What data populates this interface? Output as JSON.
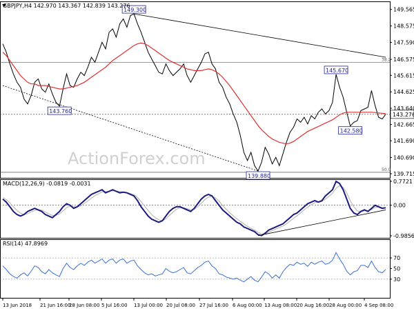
{
  "chart_data": {
    "type": "line",
    "symbol": "GBPJPY,H4",
    "header_values": "142.970 143.367 142.839 143.276",
    "x_tick_labels": [
      "13 Jun 2018",
      "21 Jun 16:00",
      "28 Jun 08:00",
      "5 Jul 16:00",
      "13 Jul 00:00",
      "20 Jul 08:00",
      "27 Jul 16:00",
      "6 Aug 00:00",
      "13 Aug 08:00",
      "20 Aug 16:00",
      "28 Aug 00:00",
      "4 Sep 08:00"
    ],
    "watermark": "ActionForex.com",
    "panels": {
      "price": {
        "ylim": [
          139.715,
          149.8
        ],
        "y_ticks": [
          "149.565",
          "148.575",
          "147.590",
          "146.575",
          "145.615",
          "144.625",
          "143.640",
          "142.665",
          "141.690",
          "140.690",
          "139.715"
        ],
        "last_price_label": "143.276",
        "series": [
          {
            "name": "Price",
            "color": "#000000",
            "values": [
              147.5,
              147.0,
              146.3,
              145.7,
              145.2,
              144.9,
              144.2,
              143.9,
              144.4,
              145.2,
              145.4,
              144.8,
              144.6,
              145.1,
              144.5,
              144.0,
              143.76,
              144.8,
              145.7,
              145.0,
              144.9,
              145.4,
              145.8,
              145.6,
              146.1,
              146.7,
              146.4,
              147.0,
              147.6,
              147.2,
              148.2,
              148.4,
              147.9,
              148.7,
              149.0,
              148.5,
              149.2,
              149.3,
              148.7,
              148.2,
              147.6,
              147.0,
              146.6,
              146.2,
              145.8,
              145.7,
              146.3,
              145.9,
              145.6,
              145.8,
              146.0,
              146.3,
              145.6,
              145.2,
              145.6,
              146.0,
              146.4,
              146.9,
              147.0,
              146.3,
              146.0,
              145.2,
              144.9,
              144.3,
              143.9,
              143.3,
              142.8,
              142.0,
              141.0,
              140.5,
              141.0,
              140.2,
              139.88,
              140.4,
              141.3,
              140.9,
              140.3,
              140.7,
              140.2,
              140.9,
              141.6,
              142.2,
              142.5,
              143.0,
              142.8,
              143.1,
              142.7,
              143.2,
              143.0,
              143.4,
              143.6,
              143.3,
              143.5,
              144.0,
              145.67,
              144.9,
              144.3,
              143.4,
              142.58,
              142.8,
              142.9,
              143.5,
              143.6,
              143.7,
              144.7,
              143.8,
              143.1,
              143.0,
              143.276
            ]
          },
          {
            "name": "SMA",
            "color": "#e03030",
            "values": [
              147.0,
              146.8,
              146.5,
              146.2,
              145.9,
              145.6,
              145.4,
              145.2,
              145.1,
              145.1,
              145.0,
              145.0,
              145.0,
              144.95,
              144.9,
              144.85,
              144.8,
              144.8,
              144.85,
              144.9,
              144.95,
              145.0,
              145.1,
              145.2,
              145.35,
              145.5,
              145.65,
              145.8,
              145.95,
              146.1,
              146.3,
              146.5,
              146.65,
              146.8,
              146.95,
              147.1,
              147.25,
              147.4,
              147.5,
              147.55,
              147.5,
              147.4,
              147.25,
              147.1,
              146.95,
              146.8,
              146.65,
              146.5,
              146.4,
              146.3,
              146.2,
              146.1,
              146.0,
              145.95,
              145.9,
              145.9,
              145.9,
              145.95,
              146.0,
              145.95,
              145.85,
              145.7,
              145.5,
              145.25,
              145.0,
              144.7,
              144.4,
              144.1,
              143.8,
              143.5,
              143.2,
              142.9,
              142.6,
              142.35,
              142.15,
              141.95,
              141.8,
              141.7,
              141.6,
              141.55,
              141.5,
              141.55,
              141.65,
              141.8,
              141.95,
              142.1,
              142.25,
              142.35,
              142.45,
              142.55,
              142.65,
              142.75,
              142.85,
              142.95,
              143.1,
              143.25,
              143.35,
              143.4,
              143.4,
              143.4,
              143.4,
              143.4,
              143.4,
              143.4,
              143.4,
              143.38,
              143.36,
              143.34,
              143.32
            ]
          }
        ],
        "annotations": [
          {
            "label": "149.300",
            "x": 37,
            "y": 149.3
          },
          {
            "label": "143.760",
            "x": 16,
            "y": 143.76
          },
          {
            "label": "139.880",
            "x": 72,
            "y": 139.88
          },
          {
            "label": "145.670",
            "x": 94,
            "y": 145.67
          },
          {
            "label": "142.580",
            "x": 98,
            "y": 142.58
          }
        ],
        "trendlines": [
          {
            "from": [
              37,
              149.3
            ],
            "to": [
              108,
              146.7
            ]
          },
          {
            "from": [
              0,
              145.0
            ],
            "to": [
              72,
              139.88
            ]
          }
        ],
        "hlines": [
          {
            "value": 146.4,
            "label": "38.2"
          },
          {
            "value": 139.8,
            "label": "50.0"
          },
          {
            "value": 143.276,
            "label": ""
          }
        ]
      },
      "macd": {
        "title": "MACD(12,26,9) -0.0819 -0.0031",
        "ylim": [
          -0.9856,
          0.7721
        ],
        "y_ticks": [
          "0.7721",
          "0.00",
          "-0.9856"
        ],
        "series": [
          {
            "name": "MACD",
            "color": "#1a1a80",
            "values": [
              0.2,
              0.1,
              -0.05,
              -0.2,
              -0.3,
              -0.35,
              -0.3,
              -0.2,
              -0.15,
              -0.1,
              -0.15,
              -0.2,
              -0.3,
              -0.35,
              -0.4,
              -0.3,
              -0.2,
              -0.05,
              0.05,
              0.0,
              -0.1,
              -0.05,
              0.05,
              0.15,
              0.25,
              0.35,
              0.4,
              0.45,
              0.5,
              0.4,
              0.45,
              0.5,
              0.45,
              0.4,
              0.42,
              0.4,
              0.35,
              0.3,
              0.15,
              -0.05,
              -0.2,
              -0.35,
              -0.45,
              -0.5,
              -0.55,
              -0.5,
              -0.35,
              -0.2,
              -0.1,
              -0.05,
              -0.05,
              -0.1,
              -0.15,
              -0.2,
              -0.1,
              0.05,
              0.2,
              0.3,
              0.35,
              0.3,
              0.15,
              0.0,
              -0.15,
              -0.25,
              -0.35,
              -0.45,
              -0.55,
              -0.6,
              -0.7,
              -0.75,
              -0.8,
              -0.85,
              -0.95,
              -0.98,
              -0.9,
              -0.8,
              -0.75,
              -0.7,
              -0.65,
              -0.6,
              -0.5,
              -0.4,
              -0.3,
              -0.25,
              -0.15,
              -0.05,
              0.05,
              0.1,
              0.15,
              0.1,
              0.15,
              0.3,
              0.4,
              0.5,
              0.77,
              0.7,
              0.5,
              0.2,
              -0.1,
              -0.25,
              -0.3,
              -0.2,
              -0.15,
              -0.2,
              -0.1,
              0.0,
              -0.05,
              -0.1,
              -0.08
            ]
          },
          {
            "name": "Signal",
            "color": "#b0b0b0",
            "values": [
              0.25,
              0.18,
              0.08,
              -0.05,
              -0.17,
              -0.25,
              -0.3,
              -0.27,
              -0.22,
              -0.17,
              -0.14,
              -0.16,
              -0.22,
              -0.28,
              -0.33,
              -0.33,
              -0.28,
              -0.18,
              -0.08,
              -0.03,
              -0.05,
              -0.06,
              -0.02,
              0.06,
              0.14,
              0.23,
              0.31,
              0.37,
              0.43,
              0.44,
              0.45,
              0.47,
              0.46,
              0.44,
              0.43,
              0.41,
              0.38,
              0.34,
              0.25,
              0.12,
              -0.03,
              -0.17,
              -0.3,
              -0.4,
              -0.47,
              -0.5,
              -0.44,
              -0.33,
              -0.22,
              -0.13,
              -0.08,
              -0.08,
              -0.11,
              -0.15,
              -0.13,
              -0.05,
              0.07,
              0.18,
              0.26,
              0.29,
              0.24,
              0.13,
              -0.01,
              -0.13,
              -0.24,
              -0.34,
              -0.44,
              -0.52,
              -0.6,
              -0.68,
              -0.74,
              -0.8,
              -0.87,
              -0.93,
              -0.92,
              -0.87,
              -0.82,
              -0.77,
              -0.72,
              -0.67,
              -0.6,
              -0.51,
              -0.42,
              -0.34,
              -0.25,
              -0.15,
              -0.06,
              0.02,
              0.08,
              0.1,
              0.12,
              0.2,
              0.29,
              0.39,
              0.55,
              0.63,
              0.58,
              0.4,
              0.15,
              -0.05,
              -0.18,
              -0.2,
              -0.18,
              -0.18,
              -0.14,
              -0.07,
              -0.06,
              -0.08,
              -0.08
            ]
          }
        ],
        "trendline": {
          "from": [
            72,
            -0.98
          ],
          "to": [
            108,
            -0.15
          ]
        },
        "zero_line": 0.0
      },
      "rsi": {
        "title": "RSI(14) 47.8969",
        "ylim": [
          0,
          100
        ],
        "y_ticks": [
          "70",
          "50",
          "30"
        ],
        "series": [
          {
            "name": "RSI",
            "color": "#3a6fd8",
            "values": [
              55,
              48,
              40,
              35,
              32,
              38,
              42,
              36,
              45,
              55,
              52,
              44,
              40,
              48,
              42,
              38,
              35,
              50,
              60,
              52,
              48,
              55,
              60,
              56,
              62,
              66,
              60,
              64,
              68,
              60,
              66,
              68,
              60,
              66,
              68,
              60,
              64,
              66,
              55,
              48,
              42,
              38,
              40,
              36,
              38,
              40,
              50,
              45,
              42,
              44,
              48,
              52,
              42,
              40,
              46,
              52,
              56,
              62,
              64,
              55,
              50,
              40,
              38,
              34,
              32,
              30,
              32,
              28,
              25,
              30,
              35,
              28,
              25,
              34,
              44,
              40,
              32,
              38,
              32,
              44,
              52,
              58,
              56,
              62,
              58,
              60,
              54,
              62,
              58,
              62,
              64,
              58,
              60,
              66,
              80,
              68,
              58,
              45,
              38,
              44,
              46,
              56,
              56,
              52,
              64,
              52,
              44,
              42,
              48
            ]
          }
        ],
        "levels": [
          70,
          30
        ]
      }
    }
  }
}
